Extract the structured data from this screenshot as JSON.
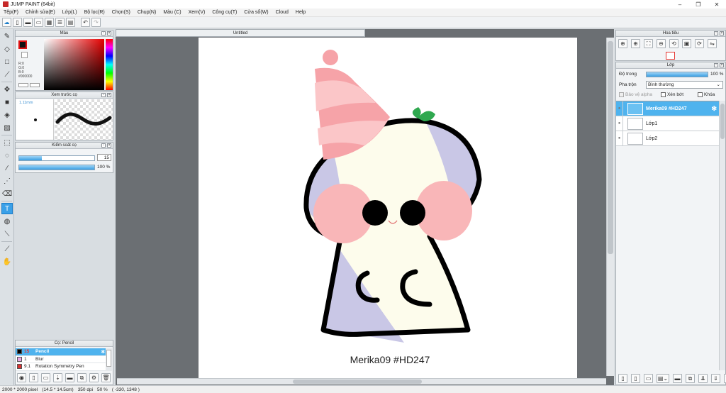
{
  "window": {
    "title": "JUMP PAINT (64bit)",
    "controls": [
      "–",
      "❐",
      "✕"
    ]
  },
  "menu": [
    "Tệp(F)",
    "Chỉnh sửa(E)",
    "Lớp(L)",
    "Bộ lọc(R)",
    "Chọn(S)",
    "Chụp(N)",
    "Màu (C)",
    "Xem(V)",
    "Công cụ(T)",
    "Cửa sổ(W)",
    "Cloud",
    "Help"
  ],
  "document": {
    "tab_title": "Untitled"
  },
  "color_panel": {
    "title": "Màu",
    "values": {
      "r": "R:0",
      "g": "G:0",
      "b": "B:0",
      "hex": "#000000"
    },
    "primary_color": "#111111",
    "secondary_color": "#ffffff"
  },
  "preview_panel": {
    "title": "Xem trước cọ",
    "size": "1.11mm"
  },
  "brush_control": {
    "title": "Kiểm soát cọ",
    "size_value": "15",
    "size_fill": 0.3,
    "opacity_value": "100 %",
    "opacity_fill": 1.0
  },
  "brush_list": {
    "title": "Cọ: Pencil",
    "items": [
      {
        "size": "15",
        "name": "Pencil",
        "color": "#000000",
        "selected": true
      },
      {
        "size": "1",
        "name": "Blur",
        "color": "#e8a6e6",
        "selected": false
      },
      {
        "size": "9.1",
        "name": "Rotation Symmetry Pen",
        "color": "#d93030",
        "selected": false
      }
    ]
  },
  "navigator": {
    "title": "Hoa tiêu"
  },
  "layer_panel": {
    "title": "Lớp",
    "opacity_label": "Độ trong",
    "opacity_value": "100 %",
    "opacity_fill": 1.0,
    "blend_label": "Pha trộn",
    "blend_value": "Bình thường",
    "protect_alpha": "Bảo vệ alpha",
    "clipping": "Xén bớt",
    "lock": "Khóa",
    "layers": [
      {
        "name": "Merika09 #HD247",
        "selected": true
      },
      {
        "name": "Lớp1",
        "selected": false
      },
      {
        "name": "Lớp2",
        "selected": false
      }
    ]
  },
  "canvas": {
    "watermark": "Merika09 #HD247"
  },
  "status": {
    "size": "2000 * 2000 pixel",
    "physical": "(14.5 * 14.5cm)",
    "dpi": "350 dpi",
    "zoom": "50 %",
    "coords": "( -330, 1348 )"
  }
}
